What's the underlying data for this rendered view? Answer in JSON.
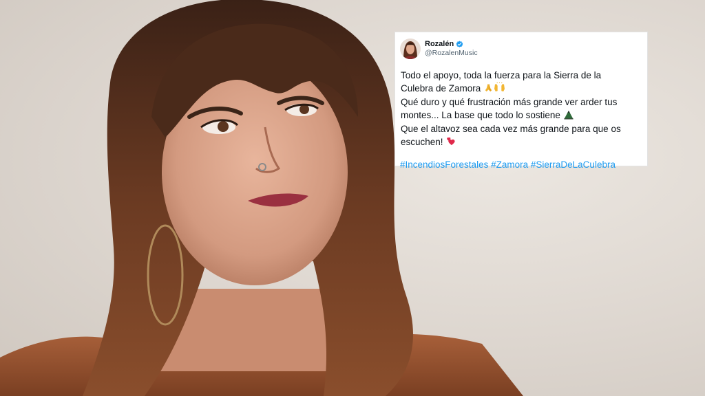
{
  "tweet": {
    "author_name": "Rozalén",
    "author_handle": "@RozalenMusic",
    "lines": [
      "Todo el apoyo, toda la fuerza para la Sierra de la",
      "Culebra de Zamora",
      "Qué duro y qué frustración más grande ver arder tus",
      "montes... La base que todo lo sostiene",
      "Que el altavoz sea cada vez más grande para que os",
      "escuchen!"
    ],
    "hashtags": [
      "#IncendiosForestales",
      "#Zamora",
      "#SierraDeLaCulebra"
    ],
    "link_color": "#1d9bf0",
    "verified_color": "#1d9bf0"
  },
  "icons": {
    "avatar": "avatar-photo",
    "verified": "verified-badge-icon",
    "emoji_1": "praying-hands-emoji",
    "emoji_2": "raised-hands-emoji",
    "emoji_3": "mountain-emoji",
    "emoji_4": "two-hearts-emoji"
  }
}
